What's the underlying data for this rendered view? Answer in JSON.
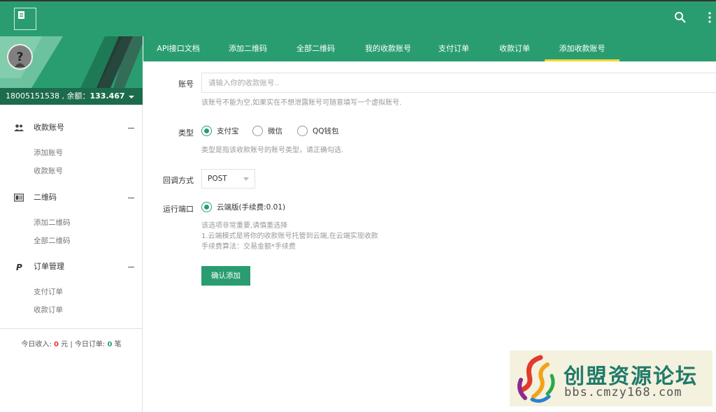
{
  "header": {
    "logo_icon": "document-icon",
    "actions": [
      "search-icon",
      "more-vertical-icon"
    ],
    "brand_color": "#2a9d70"
  },
  "sidebar": {
    "account_phone": "18005151538",
    "balance_label": "余额：",
    "balance_value": "133.467",
    "groups": [
      {
        "label": "收款账号",
        "icon": "users-icon",
        "items": [
          "添加账号",
          "收款账号"
        ]
      },
      {
        "label": "二维码",
        "icon": "qrcode-card-icon",
        "items": [
          "添加二维码",
          "全部二维码"
        ]
      },
      {
        "label": "订单管理",
        "icon": "paypal-icon",
        "items": [
          "支付订单",
          "收款订单"
        ]
      }
    ],
    "footer": {
      "income_label": "今日收入:",
      "income_value": "0",
      "income_unit": "元",
      "divider": "|",
      "orders_label": "今日订单:",
      "orders_value": "0",
      "orders_unit": "笔"
    }
  },
  "tabs": [
    {
      "label": "API接口文档"
    },
    {
      "label": "添加二维码"
    },
    {
      "label": "全部二维码"
    },
    {
      "label": "我的收款账号"
    },
    {
      "label": "支付订单"
    },
    {
      "label": "收款订单"
    },
    {
      "label": "添加收款账号",
      "active": true
    }
  ],
  "form": {
    "account": {
      "label": "账号",
      "placeholder": "请输入你的收款账号..",
      "hint": "该账号不能为空,如果实在不想泄露账号可随意填写一个虚拟账号."
    },
    "type": {
      "label": "类型",
      "options": [
        "支付宝",
        "微信",
        "QQ钱包"
      ],
      "selected": "支付宝",
      "hint": "类型是指该收款账号的账号类型，请正确勾选."
    },
    "callback": {
      "label": "回调方式",
      "value": "POST"
    },
    "port": {
      "label": "运行端口",
      "option": "云端版(手续费:0.01)",
      "hints": [
        "该选项非常重要,请慎重选择",
        "1.云端模式是将你的收款账号托管到云端,在云端实现收款",
        "手续费算法：交易金额*手续费"
      ]
    },
    "submit_label": "确认添加"
  },
  "watermark": {
    "title": "创盟资源论坛",
    "url": "bbs.cmzy168.com"
  }
}
